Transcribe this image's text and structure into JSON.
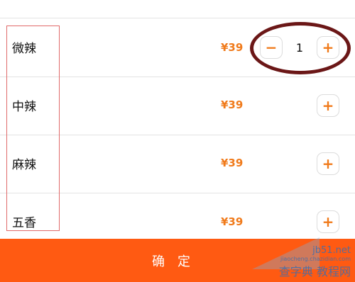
{
  "items": [
    {
      "name": "微辣",
      "price": "¥39",
      "qty": "1",
      "minus": "−",
      "plus": "+"
    },
    {
      "name": "中辣",
      "price": "¥39",
      "plus": "+"
    },
    {
      "name": "麻辣",
      "price": "¥39",
      "plus": "+"
    },
    {
      "name": "五香",
      "price": "¥39",
      "plus": "+"
    }
  ],
  "confirm_label": "确定",
  "watermark": {
    "line1": "jb51.net",
    "line2": "jiaocheng.chazidian.com",
    "line3": "查字典 教程网"
  },
  "colors": {
    "accent": "#f07a1a",
    "confirm_bg": "#ff5a12",
    "annotation_box": "#e06a6a",
    "annotation_ellipse": "#6b1717"
  }
}
